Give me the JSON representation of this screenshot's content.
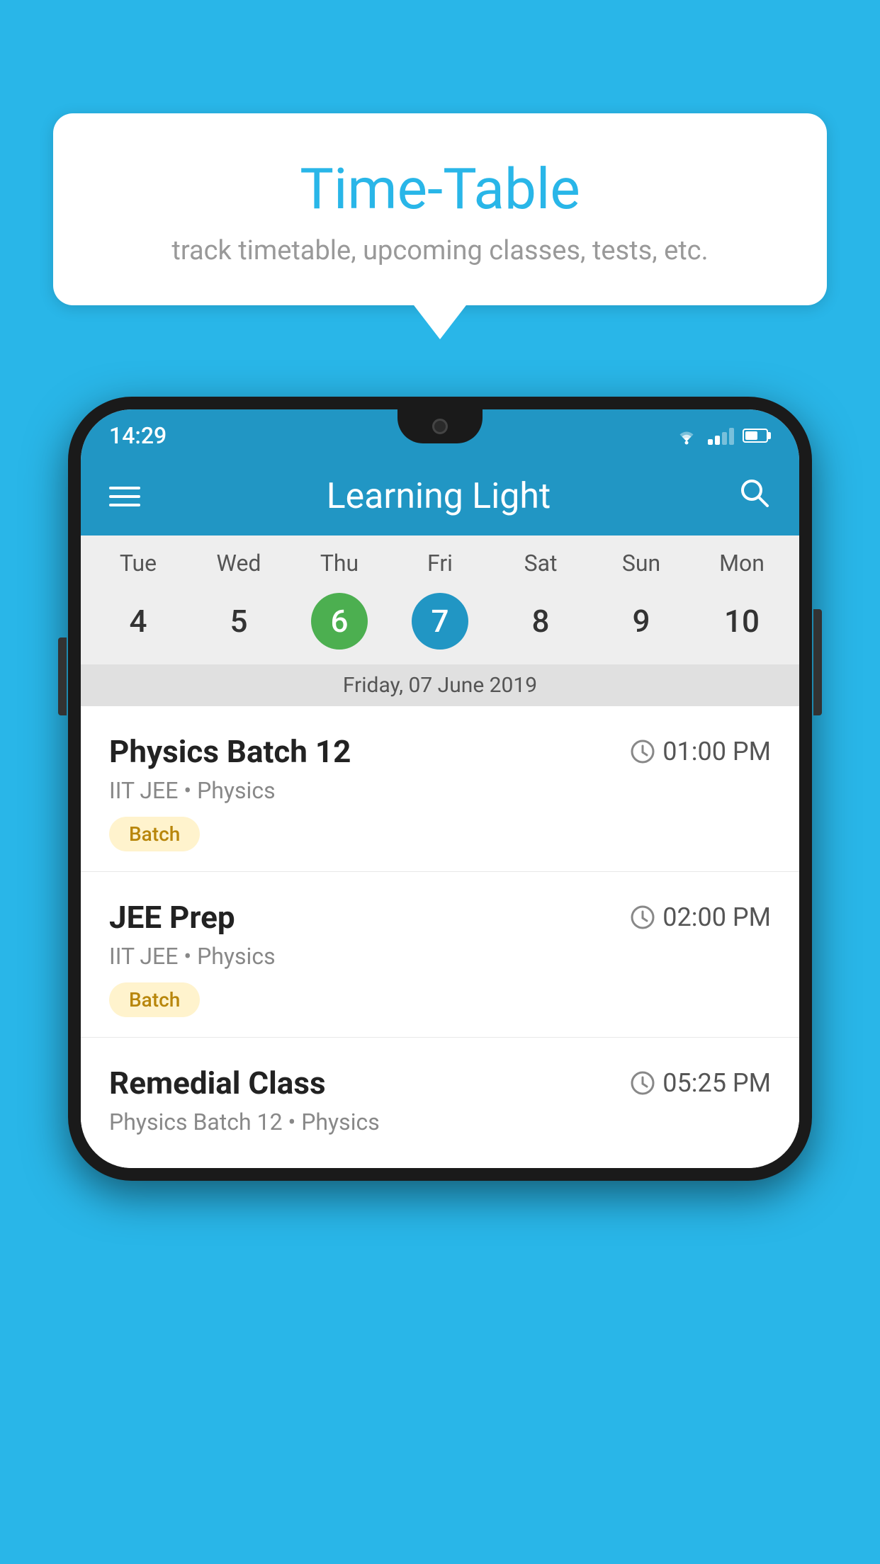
{
  "background_color": "#29b6e8",
  "speech_bubble": {
    "title": "Time-Table",
    "subtitle": "track timetable, upcoming classes, tests, etc."
  },
  "phone": {
    "status_bar": {
      "time": "14:29"
    },
    "app_bar": {
      "title": "Learning Light"
    },
    "calendar": {
      "days": [
        "Tue",
        "Wed",
        "Thu",
        "Fri",
        "Sat",
        "Sun",
        "Mon"
      ],
      "dates": [
        {
          "num": "4",
          "state": "normal"
        },
        {
          "num": "5",
          "state": "normal"
        },
        {
          "num": "6",
          "state": "today"
        },
        {
          "num": "7",
          "state": "selected"
        },
        {
          "num": "8",
          "state": "normal"
        },
        {
          "num": "9",
          "state": "normal"
        },
        {
          "num": "10",
          "state": "normal"
        }
      ],
      "selected_date_label": "Friday, 07 June 2019"
    },
    "classes": [
      {
        "name": "Physics Batch 12",
        "time": "01:00 PM",
        "meta": "IIT JEE • Physics",
        "badge": "Batch"
      },
      {
        "name": "JEE Prep",
        "time": "02:00 PM",
        "meta": "IIT JEE • Physics",
        "badge": "Batch"
      },
      {
        "name": "Remedial Class",
        "time": "05:25 PM",
        "meta": "Physics Batch 12 • Physics",
        "badge": null
      }
    ]
  }
}
